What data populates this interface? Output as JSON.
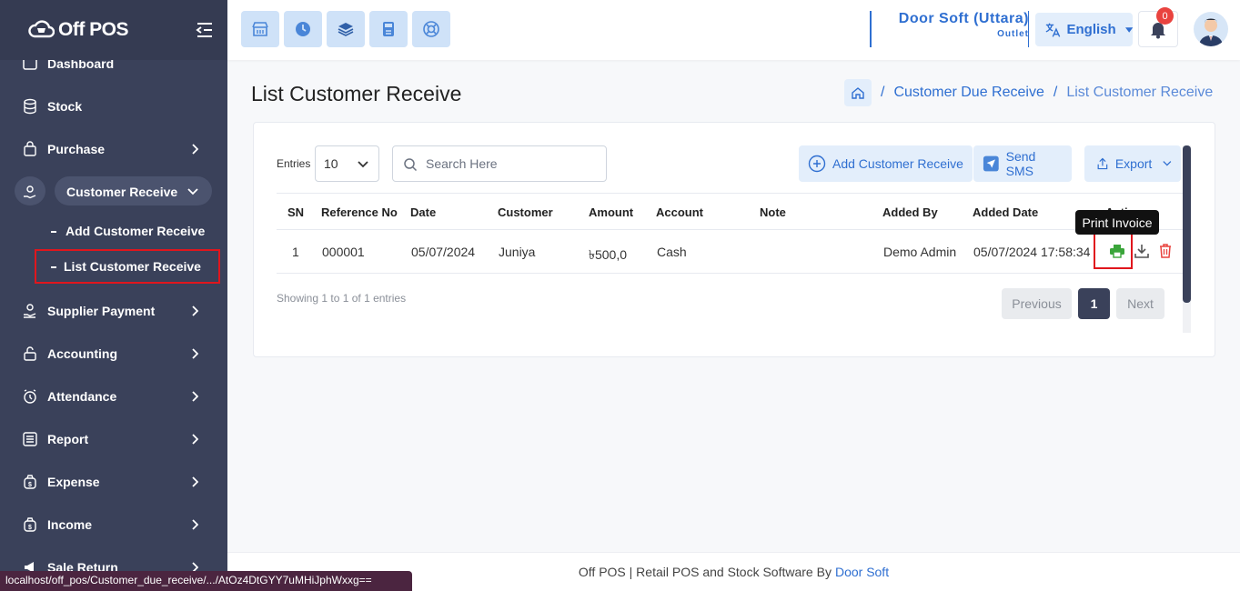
{
  "app": {
    "logo_text": "Off POS"
  },
  "sidebar": {
    "partial_item": "Dashboard",
    "items": [
      {
        "label": "Stock",
        "icon": "database-icon"
      },
      {
        "label": "Purchase",
        "icon": "bag-icon"
      },
      {
        "label": "Customer Receive",
        "icon": "hand-coin-icon",
        "expanded": true
      },
      {
        "label": "Supplier Payment",
        "icon": "hand-money-icon"
      },
      {
        "label": "Accounting",
        "icon": "lock-open-icon"
      },
      {
        "label": "Attendance",
        "icon": "alarm-icon"
      },
      {
        "label": "Report",
        "icon": "list-icon"
      },
      {
        "label": "Expense",
        "icon": "money-bag-icon"
      },
      {
        "label": "Income",
        "icon": "money-bag-icon"
      },
      {
        "label": "Sale Return",
        "icon": "megaphone-icon"
      }
    ],
    "subitems": [
      {
        "label": "Add Customer Receive"
      },
      {
        "label": "List Customer Receive",
        "active": true
      }
    ]
  },
  "topbar": {
    "outlet_name": "Door Soft (Uttara)",
    "outlet_label": "Outlet",
    "language": "English",
    "notification_count": "0"
  },
  "page": {
    "title": "List Customer Receive",
    "breadcrumb": [
      "Customer Due Receive",
      "List Customer Receive"
    ]
  },
  "toolbar": {
    "entries_label": "Entries",
    "entries_value": "10",
    "search_placeholder": "Search Here",
    "add_label": "Add Customer Receive",
    "sms_label": "Send SMS",
    "export_label": "Export"
  },
  "table": {
    "headers": [
      "SN",
      "Reference No",
      "Date",
      "Customer",
      "Amount",
      "Account",
      "Note",
      "Added By",
      "Added Date",
      "Actions"
    ],
    "rows": [
      {
        "sn": "1",
        "ref": "000001",
        "date": "05/07/2024",
        "customer": "Juniya",
        "amount": "৳500,0",
        "account": "Cash",
        "note": "",
        "added_by": "Demo Admin",
        "added_date": "05/07/2024 17:58:34"
      }
    ]
  },
  "tooltip": "Print Invoice",
  "pagination": {
    "showing": "Showing 1 to 1 of 1 entries",
    "previous": "Previous",
    "current": "1",
    "next": "Next"
  },
  "footer": {
    "text": "Off POS | Retail POS and Stock Software By",
    "link": "Door Soft"
  },
  "statusbar": {
    "url": "localhost/off_pos/Customer_due_receive/.../AtOz4DtGYY7uMHiJphWxxg=="
  },
  "colors": {
    "sidebar": "#3a415a",
    "accent": "#2f6fd1",
    "print_icon": "#3aa53a",
    "delete_icon": "#e9433f",
    "highlight": "#e0161d"
  }
}
